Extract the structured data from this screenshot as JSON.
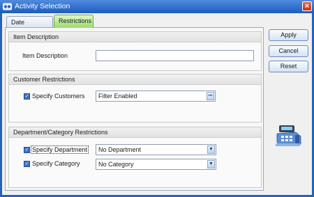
{
  "window": {
    "title": "Activity Selection",
    "close_glyph": "×"
  },
  "tabs": [
    {
      "label": "Date Selection",
      "selected": false
    },
    {
      "label": "Restrictions",
      "selected": true
    }
  ],
  "item_description": {
    "group_title": "Item Description",
    "field_label": "Item Description",
    "value": ""
  },
  "customer_restrictions": {
    "group_title": "Customer Restrictions",
    "specify_label": "Specify Customers",
    "checked": true,
    "filter_value": "Filter Enabled",
    "browse_glyph": "•••"
  },
  "department_restrictions": {
    "group_title": "Department/Category Restrictions",
    "department_label": "Specify Department",
    "department_checked": true,
    "department_value": "No Department",
    "category_label": "Specify Category",
    "category_checked": true,
    "category_value": "No Category"
  },
  "actions": {
    "apply": "Apply",
    "cancel": "Cancel",
    "reset": "Reset"
  },
  "icons": {
    "window_icon": "activity-icon",
    "decoration": "cash-register-icon"
  }
}
